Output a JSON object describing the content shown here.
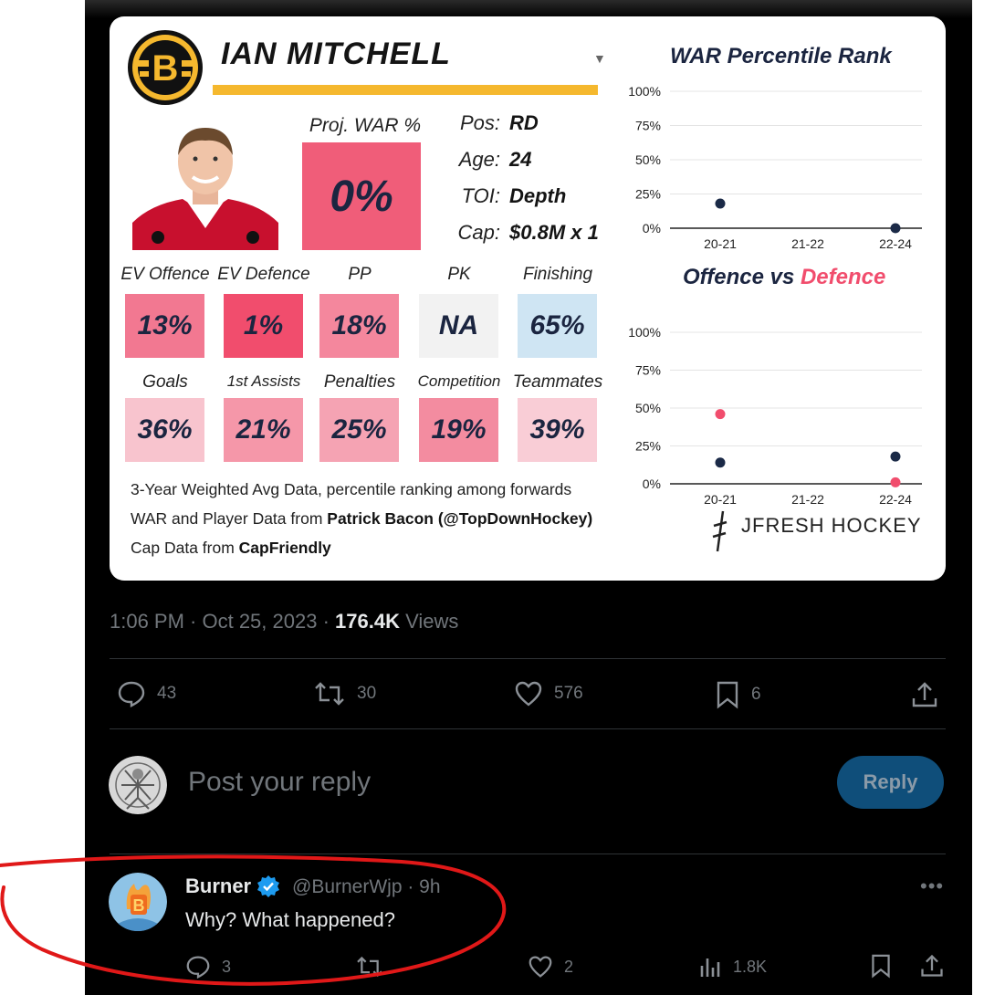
{
  "player": {
    "name": "IAN MITCHELL",
    "proj_label": "Proj. WAR %",
    "proj_value": "0%",
    "info": [
      {
        "key": "Pos:",
        "value": "RD"
      },
      {
        "key": "Age:",
        "value": "24"
      },
      {
        "key": "TOI:",
        "value": "Depth"
      },
      {
        "key": "Cap:",
        "value": "$0.8M x 1"
      }
    ]
  },
  "metrics": [
    {
      "label": "EV Offence",
      "value": "13%",
      "color": "#f27891"
    },
    {
      "label": "EV Defence",
      "value": "1%",
      "color": "#f14d6d"
    },
    {
      "label": "PP",
      "value": "18%",
      "color": "#f4879d"
    },
    {
      "label": "PK",
      "value": "NA",
      "color": "#f2f2f2"
    },
    {
      "label": "Finishing",
      "value": "65%",
      "color": "#cfe5f3"
    },
    {
      "label": "Goals",
      "value": "36%",
      "color": "#f8c4ce"
    },
    {
      "label": "1st Assists",
      "value": "21%",
      "color": "#f597a9"
    },
    {
      "label": "Penalties",
      "value": "25%",
      "color": "#f5a3b3"
    },
    {
      "label": "Competition",
      "value": "19%",
      "color": "#f38ca0"
    },
    {
      "label": "Teammates",
      "value": "39%",
      "color": "#f9cdd6"
    }
  ],
  "footer": {
    "line1": "3-Year Weighted Avg Data, percentile ranking among forwards",
    "line2_prefix": "WAR and Player Data from ",
    "line2_bold": "Patrick Bacon (@TopDownHockey)",
    "line3_prefix": "Cap Data from ",
    "line3_bold": "CapFriendly",
    "brand": "JFRESH HOCKEY"
  },
  "chart_data": [
    {
      "type": "scatter",
      "title": "WAR Percentile Rank",
      "categories": [
        "20-21",
        "21-22",
        "22-24"
      ],
      "yticks": [
        "0%",
        "25%",
        "50%",
        "75%",
        "100%"
      ],
      "ylim": [
        0,
        100
      ],
      "grid": true,
      "series": [
        {
          "values": [
            18,
            null,
            0
          ],
          "color": "#1b2a47"
        }
      ]
    },
    {
      "type": "scatter",
      "title_part1": "Offence vs ",
      "title_part2": "Defence",
      "title_part2_color": "#f14d6d",
      "categories": [
        "20-21",
        "21-22",
        "22-24"
      ],
      "yticks": [
        "0%",
        "25%",
        "50%",
        "75%",
        "100%"
      ],
      "ylim": [
        0,
        100
      ],
      "grid": true,
      "series": [
        {
          "values": [
            14,
            null,
            18
          ],
          "color": "#1b2a47"
        },
        {
          "values": [
            46,
            null,
            1
          ],
          "color": "#f14d6d"
        }
      ]
    }
  ],
  "tweet": {
    "time": "1:06 PM · Oct 25, 2023 · ",
    "views_count": "176.4K",
    "views_label": " Views",
    "replies": "43",
    "retweets": "30",
    "likes": "576",
    "bookmarks": "6"
  },
  "compose": {
    "placeholder": "Post your reply",
    "button": "Reply"
  },
  "comment": {
    "name": "Burner",
    "handle": "@BurnerWjp · 9h",
    "text": "Why? What happened?",
    "replies": "3",
    "likes": "2",
    "views": "1.8K"
  },
  "colors": {
    "annotation": "#e01818",
    "verified": "#1d9bf0",
    "gold": "#f5b82e"
  }
}
